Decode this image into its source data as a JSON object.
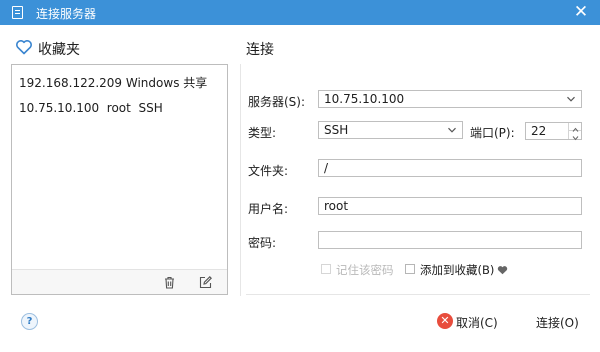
{
  "window": {
    "title": "连接服务器",
    "close_glyph": "✕"
  },
  "favorites": {
    "title": "收藏夹",
    "items": [
      "192.168.122.209 Windows 共享",
      "10.75.10.100  root  SSH"
    ],
    "delete_icon": "trash-icon",
    "edit_icon": "edit-icon"
  },
  "connection": {
    "title": "连接",
    "server_label": "服务器(S):",
    "server_value": "10.75.10.100",
    "type_label": "类型:",
    "type_value": "SSH",
    "port_label": "端口(P):",
    "port_value": "22",
    "folder_label": "文件夹:",
    "folder_value": "/",
    "username_label": "用户名:",
    "username_value": "root",
    "password_label": "密码:",
    "password_value": "",
    "remember_label": "记住该密码",
    "add_fav_label": "添加到收藏(B)"
  },
  "footer": {
    "help": "?",
    "cancel_label": "取消(C)",
    "connect_label": "连接(O)"
  },
  "colors": {
    "titlebar": "#3c91d8",
    "accent": "#2f7bc4",
    "cancel_icon": "#e84d3d"
  }
}
